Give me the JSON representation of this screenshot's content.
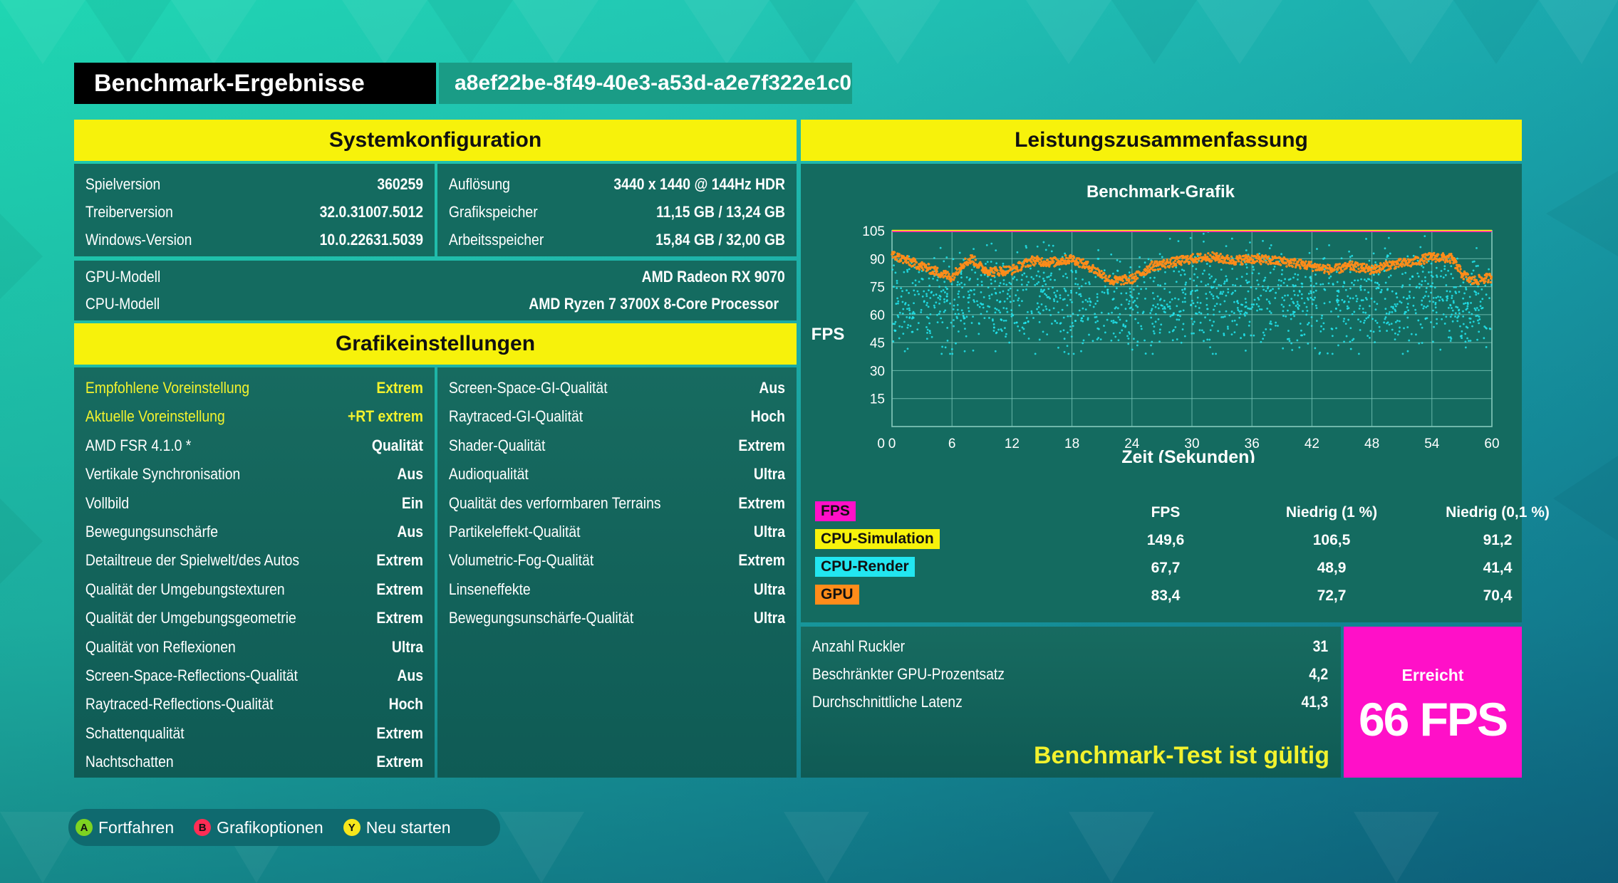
{
  "header": {
    "title": "Benchmark-Ergebnisse",
    "run_id": "a8ef22be-8f49-40e3-a53d-a2e7f322e1c0"
  },
  "system": {
    "title": "Systemkonfiguration",
    "left": [
      {
        "label": "Spielversion",
        "value": "360259"
      },
      {
        "label": "Treiberversion",
        "value": "32.0.31007.5012"
      },
      {
        "label": "Windows-Version",
        "value": "10.0.22631.5039"
      }
    ],
    "right": [
      {
        "label": "Auflösung",
        "value": "3440 x 1440 @ 144Hz HDR"
      },
      {
        "label": "Grafikspeicher",
        "value": "11,15 GB / 13,24 GB"
      },
      {
        "label": "Arbeitsspeicher",
        "value": "15,84 GB / 32,00 GB"
      }
    ],
    "hardware": [
      {
        "label": "GPU-Modell",
        "value": "AMD Radeon RX 9070"
      },
      {
        "label": "CPU-Modell",
        "value": "AMD Ryzen 7 3700X 8-Core Processor"
      }
    ]
  },
  "graphics": {
    "title": "Grafikeinstellungen",
    "left": [
      {
        "label": "Empfohlene Voreinstellung",
        "value": "Extrem"
      },
      {
        "label": "Aktuelle Voreinstellung",
        "value": "+RT extrem"
      },
      {
        "label": "AMD FSR 4.1.0 *",
        "value": "Qualität"
      },
      {
        "label": "Vertikale Synchronisation",
        "value": "Aus"
      },
      {
        "label": "Vollbild",
        "value": "Ein"
      },
      {
        "label": "Bewegungsunschärfe",
        "value": "Aus"
      },
      {
        "label": "Detailtreue der Spielwelt/des Autos",
        "value": "Extrem"
      },
      {
        "label": "Qualität der Umgebungstexturen",
        "value": "Extrem"
      },
      {
        "label": "Qualität der Umgebungsgeometrie",
        "value": "Extrem"
      },
      {
        "label": "Qualität von Reflexionen",
        "value": "Ultra"
      },
      {
        "label": "Screen-Space-Reflections-Qualität",
        "value": "Aus"
      },
      {
        "label": "Raytraced-Reflections-Qualität",
        "value": "Hoch"
      },
      {
        "label": "Schattenqualität",
        "value": "Extrem"
      },
      {
        "label": "Nachtschatten",
        "value": "Extrem"
      }
    ],
    "right": [
      {
        "label": "Screen-Space-GI-Qualität",
        "value": "Aus"
      },
      {
        "label": "Raytraced-GI-Qualität",
        "value": "Hoch"
      },
      {
        "label": "Shader-Qualität",
        "value": "Extrem"
      },
      {
        "label": "Audioqualität",
        "value": "Ultra"
      },
      {
        "label": "Qualität des verformbaren Terrains",
        "value": "Extrem"
      },
      {
        "label": "Partikeleffekt-Qualität",
        "value": "Ultra"
      },
      {
        "label": "Volumetric-Fog-Qualität",
        "value": "Extrem"
      },
      {
        "label": "Linseneffekte",
        "value": "Ultra"
      },
      {
        "label": "Bewegungsunschärfe-Qualität",
        "value": "Ultra"
      }
    ]
  },
  "performance": {
    "title": "Leistungszusammenfassung",
    "table_headers": [
      "FPS",
      "Niedrig (1 %)",
      "Niedrig (0,1 %)"
    ],
    "legend": [
      {
        "name": "FPS",
        "color": "#ff10c8"
      },
      {
        "name": "CPU-Simulation",
        "color": "#f7f20b",
        "values": [
          "149,6",
          "106,5",
          "91,2"
        ]
      },
      {
        "name": "CPU-Render",
        "color": "#22e6f0",
        "values": [
          "67,7",
          "48,9",
          "41,4"
        ]
      },
      {
        "name": "GPU",
        "color": "#ff8c1a",
        "values": [
          "83,4",
          "72,7",
          "70,4"
        ]
      }
    ],
    "stats": [
      {
        "label": "Anzahl Ruckler",
        "value": "31"
      },
      {
        "label": "Beschränkter GPU-Prozentsatz",
        "value": "4,2"
      },
      {
        "label": "Durchschnittliche Latenz",
        "value": "41,3"
      }
    ],
    "valid_text": "Benchmark-Test ist gültig",
    "achieved_label": "Erreicht",
    "achieved_value": "66 FPS",
    "achieved_color": "#ff10c8"
  },
  "chart_data": {
    "type": "scatter",
    "title": "Benchmark-Grafik",
    "xlabel": "Zeit (Sekunden)",
    "ylabel": "FPS",
    "xlim": [
      0,
      60
    ],
    "ylim": [
      0,
      105
    ],
    "xticks": [
      "0",
      "6",
      "12",
      "18",
      "24",
      "30",
      "36",
      "42",
      "48",
      "54",
      "60"
    ],
    "yticks": [
      "105",
      "90",
      "75",
      "60",
      "45",
      "30",
      "15",
      "0"
    ],
    "grid": true,
    "series": [
      {
        "name": "CPU-Simulation",
        "color": "#f7f20b",
        "style": "line",
        "x": [
          0,
          60
        ],
        "values": [
          105,
          105
        ]
      },
      {
        "name": "FPS",
        "color": "#ff10c8",
        "style": "line",
        "x": [
          0,
          60
        ],
        "values": [
          104.5,
          104.5
        ]
      },
      {
        "name": "GPU",
        "color": "#ff8c1a",
        "style": "dense-points",
        "x": [
          0,
          2,
          4,
          6,
          7,
          8,
          9,
          10,
          12,
          14,
          16,
          18,
          20,
          22,
          24,
          26,
          28,
          30,
          32,
          34,
          36,
          38,
          40,
          42,
          44,
          46,
          48,
          50,
          52,
          54,
          56,
          57,
          58,
          60
        ],
        "values": [
          92,
          88,
          84,
          80,
          87,
          90,
          85,
          83,
          84,
          89,
          88,
          90,
          85,
          78,
          79,
          86,
          88,
          90,
          91,
          89,
          90,
          89,
          88,
          86,
          84,
          86,
          84,
          87,
          88,
          91,
          90,
          82,
          78,
          80
        ]
      },
      {
        "name": "CPU-Render",
        "color": "#22e6f0",
        "style": "scatter-band",
        "x": [
          0,
          3,
          6,
          9,
          12,
          15,
          18,
          21,
          24,
          27,
          30,
          33,
          36,
          39,
          42,
          45,
          48,
          51,
          54,
          57,
          60
        ],
        "values": [
          68,
          66,
          67,
          70,
          67,
          69,
          66,
          65,
          62,
          66,
          70,
          71,
          69,
          68,
          66,
          67,
          72,
          70,
          74,
          62,
          66
        ],
        "spread": [
          45,
          90
        ]
      }
    ]
  },
  "footer": {
    "buttons": [
      {
        "key": "A",
        "label": "Fortfahren",
        "color": "#7ed321"
      },
      {
        "key": "B",
        "label": "Grafikoptionen",
        "color": "#ff2d55"
      },
      {
        "key": "Y",
        "label": "Neu starten",
        "color": "#f7e71c"
      }
    ]
  }
}
